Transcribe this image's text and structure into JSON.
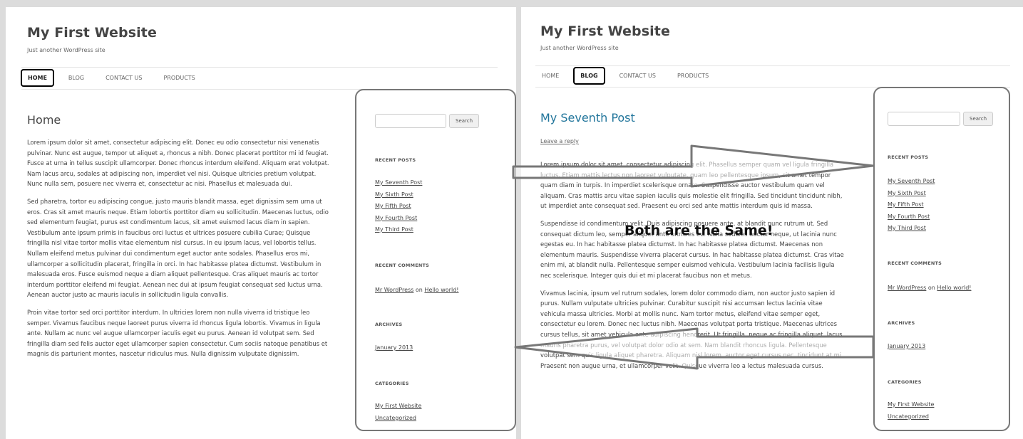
{
  "site": {
    "title": "My First Website",
    "tagline": "Just another WordPress site"
  },
  "nav": {
    "home": "HOME",
    "blog": "BLOG",
    "contact": "CONTACT US",
    "products": "PRODUCTS"
  },
  "left_page": {
    "title": "Home",
    "paragraphs": [
      "Lorem ipsum dolor sit amet, consectetur adipiscing elit. Donec eu odio consectetur nisi venenatis pulvinar. Nunc est augue, tempor ut aliquet a, rhoncus a nibh. Donec placerat porttitor mi id feugiat. Fusce at urna in tellus suscipit ullamcorper. Donec rhoncus interdum eleifend. Aliquam erat volutpat. Nam lacus arcu, sodales at adipiscing non, imperdiet vel nisi. Quisque ultricies pretium volutpat. Nunc nulla sem, posuere nec viverra et, consectetur ac nisi. Phasellus et malesuada dui.",
      "Sed pharetra, tortor eu adipiscing congue, justo mauris blandit massa, eget dignissim sem urna ut eros. Cras sit amet mauris neque. Etiam lobortis porttitor diam eu sollicitudin. Maecenas luctus, odio sed elementum feugiat, purus est condimentum lacus, sit amet euismod lacus diam in sapien. Vestibulum ante ipsum primis in faucibus orci luctus et ultrices posuere cubilia Curae; Quisque fringilla nisl vitae tortor mollis vitae elementum nisl cursus. In eu ipsum lacus, vel lobortis tellus. Nullam eleifend metus pulvinar dui condimentum eget auctor ante sodales. Phasellus eros mi, ullamcorper a sollicitudin placerat, fringilla in orci. In hac habitasse platea dictumst. Vestibulum in malesuada eros. Fusce euismod neque a diam aliquet pellentesque. Cras aliquet mauris ac tortor interdum porttitor eleifend mi feugiat. Aenean nec dui at ipsum feugiat consequat sed luctus urna. Aenean auctor justo ac mauris iaculis in sollicitudin ligula convallis.",
      "Proin vitae tortor sed orci porttitor interdum. In ultricies lorem non nulla viverra id tristique leo semper. Vivamus faucibus neque laoreet purus viverra id rhoncus ligula lobortis. Vivamus in ligula ante. Nullam ac nunc vel augue ullamcorper iaculis eget eu purus. Aenean id volutpat sem. Sed fringilla diam sed felis auctor eget ullamcorper sapien consectetur. Cum sociis natoque penatibus et magnis dis parturient montes, nascetur ridiculus mus. Nulla dignissim vulputate dignissim."
    ]
  },
  "right_page": {
    "title": "My Seventh Post",
    "reply": "Leave a reply",
    "paragraphs": [
      "Lorem ipsum dolor sit amet, consectetur adipiscing elit. Phasellus semper quam vel ligula fringilla luctus. Etiam mattis lectus non laoreet vulputate, quam leo pellentesque ipsum, sit amet tempor quam diam in turpis. In imperdiet scelerisque ornare. Suspendisse auctor vestibulum quam vel aliquam. Cras mattis arcu vitae sapien iaculis quis molestie elit fringilla. Sed tincidunt tincidunt nibh, ut imperdiet ante consequat sed. Praesent eu orci sed ante mattis interdum quis id massa.",
      "Suspendisse id condimentum velit. Duis adipiscing posuere ante, at blandit nunc rutrum ut. Sed consequat dictum leo, semper aliquet ante ultricies eu. Nulla sodales auctor neque, ut lacinia nunc egestas eu. In hac habitasse platea dictumst. In hac habitasse platea dictumst. Maecenas non elementum mauris. Suspendisse viverra placerat cursus. In hac habitasse platea dictumst. Cras vitae enim mi, at blandit nulla. Pellentesque semper euismod vehicula. Vestibulum lacinia facilisis ligula nec scelerisque. Integer quis dui et mi placerat faucibus non et metus.",
      "Vivamus lacinia, ipsum vel rutrum sodales, lorem dolor commodo diam, non auctor justo sapien id purus. Nullam vulputate ultricies pulvinar. Curabitur suscipit nisi accumsan lectus lacinia vitae vehicula massa ultricies. Morbi at mollis nunc. Nam tortor metus, eleifend vitae semper eget, consectetur eu lorem. Donec nec luctus nibh. Maecenas volutpat porta tristique. Maecenas ultrices cursus tellus, sit amet vehicula ante adipiscing hendrerit. Ut fringilla, neque ac fringilla aliquet, lacus mauris pharetra purus, vel volutpat dolor odio at sem. Nam blandit rhoncus ligula. Pellentesque volutpat sem quis ligula aliquet pharetra. Aliquam nisl lorem, auctor eget cursus nec, tincidunt at mi. Praesent non augue urna, et ullamcorper velit. Quisque viverra leo a lectus malesuada cursus."
    ]
  },
  "sidebar": {
    "search_button": "Search",
    "recent_posts_heading": "RECENT POSTS",
    "recent_posts": [
      "My Seventh Post",
      "My Sixth Post",
      "My Fifth Post",
      "My Fourth Post",
      "My Third Post"
    ],
    "recent_comments_heading": "RECENT COMMENTS",
    "comment_author": "Mr WordPress",
    "comment_on": "on",
    "comment_post": "Hello world!",
    "archives_heading": "ARCHIVES",
    "archives": [
      "January 2013"
    ],
    "categories_heading": "CATEGORIES",
    "categories": [
      "My First Website",
      "Uncategorized"
    ]
  },
  "annotation": {
    "text": "Both are the Same!"
  }
}
